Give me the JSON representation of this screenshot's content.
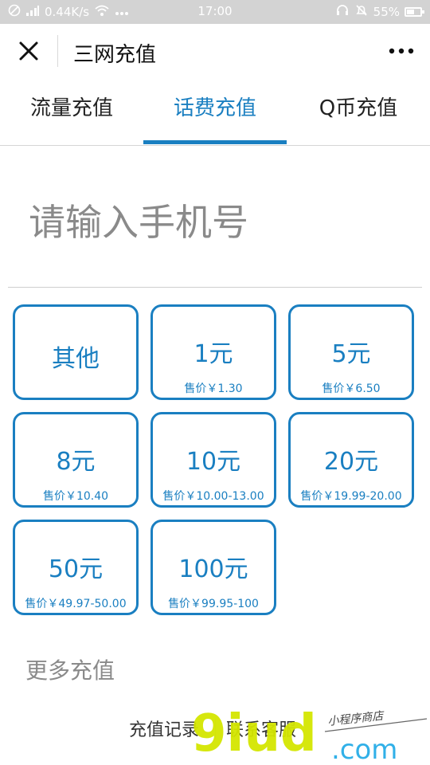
{
  "status_bar": {
    "network_speed": "0.44K/s",
    "time": "17:00",
    "battery": "55%",
    "battery_level": 0.55
  },
  "nav": {
    "title": "三网充值"
  },
  "tabs": [
    {
      "label": "流量充值",
      "active": false
    },
    {
      "label": "话费充值",
      "active": true
    },
    {
      "label": "Q币充值",
      "active": false
    }
  ],
  "phone_input": {
    "placeholder": "请输入手机号",
    "value": ""
  },
  "options": [
    {
      "amount": "其他",
      "price": ""
    },
    {
      "amount": "1元",
      "price": "售价￥1.30"
    },
    {
      "amount": "5元",
      "price": "售价￥6.50"
    },
    {
      "amount": "8元",
      "price": "售价￥10.40"
    },
    {
      "amount": "10元",
      "price": "售价￥10.00-13.00"
    },
    {
      "amount": "20元",
      "price": "售价￥19.99-20.00"
    },
    {
      "amount": "50元",
      "price": "售价￥49.97-50.00"
    },
    {
      "amount": "100元",
      "price": "售价￥99.95-100"
    }
  ],
  "more_recharge": "更多充值",
  "footer": {
    "records": "充值记录",
    "service": "联系客服"
  },
  "watermark": {
    "brand": "9iud",
    "domain": ".com",
    "tagline": "小程序商店"
  },
  "colors": {
    "accent": "#1a7fc1",
    "status_bar": "#d3d3d3"
  }
}
